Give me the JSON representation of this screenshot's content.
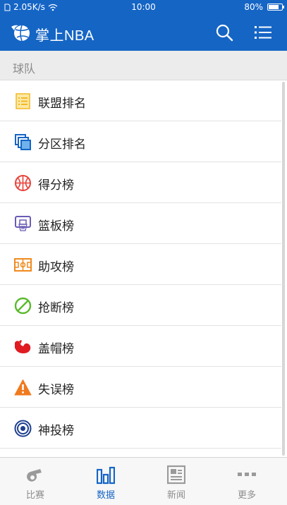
{
  "status_bar": {
    "speed": "2.05K/s",
    "time": "10:00",
    "battery": "80%",
    "battery_level": 0.8
  },
  "app_bar": {
    "title": "掌上NBA",
    "logo_icon": "basketball-logo-icon",
    "search_icon": "search-icon",
    "menu_icon": "list-menu-icon"
  },
  "section": {
    "header": "球队"
  },
  "items": [
    {
      "label": "联盟排名",
      "icon": "ranking-list-icon",
      "color": "#f2b824"
    },
    {
      "label": "分区排名",
      "icon": "stacked-windows-icon",
      "color": "#1565c5"
    },
    {
      "label": "得分榜",
      "icon": "basketball-icon",
      "color": "#e8413a"
    },
    {
      "label": "篮板榜",
      "icon": "hoop-icon",
      "color": "#6a5bb5"
    },
    {
      "label": "助攻榜",
      "icon": "court-icon",
      "color": "#f08a1e"
    },
    {
      "label": "抢断榜",
      "icon": "no-entry-icon",
      "color": "#5ab92c"
    },
    {
      "label": "盖帽榜",
      "icon": "flexed-arm-icon",
      "color": "#e01b22"
    },
    {
      "label": "失误榜",
      "icon": "warning-icon",
      "color": "#f07a1e"
    },
    {
      "label": "神投榜",
      "icon": "target-icon",
      "color": "#1d3f8f"
    }
  ],
  "bottom_nav": [
    {
      "label": "比赛",
      "icon": "whistle-icon",
      "active": false
    },
    {
      "label": "数据",
      "icon": "bar-chart-icon",
      "active": true
    },
    {
      "label": "新闻",
      "icon": "newspaper-icon",
      "active": false
    },
    {
      "label": "更多",
      "icon": "more-dots-icon",
      "active": false
    }
  ],
  "colors": {
    "primary": "#1565c5",
    "inactive_nav": "#8e8e8e"
  }
}
